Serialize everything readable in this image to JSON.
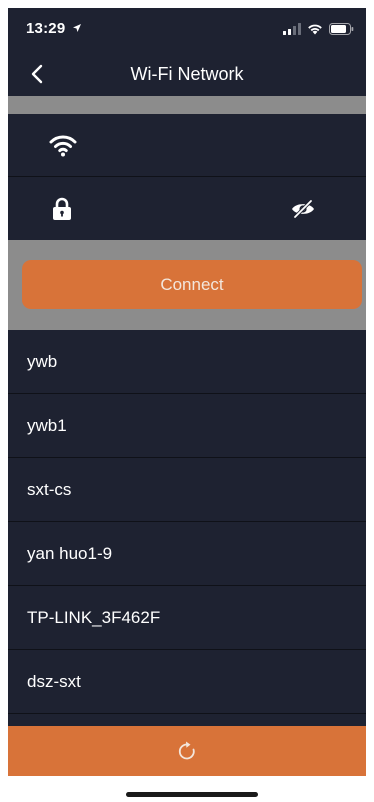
{
  "status_bar": {
    "time": "13:29",
    "location_icon": "location-arrow-icon",
    "signal_icon": "cellular-signal-icon",
    "wifi_icon": "wifi-status-icon",
    "battery_icon": "battery-icon"
  },
  "nav": {
    "title": "Wi-Fi Network",
    "back_icon": "chevron-left-icon"
  },
  "form": {
    "ssid_icon": "wifi-icon",
    "ssid_value": "",
    "password_icon": "lock-icon",
    "password_value": "",
    "visibility_icon": "eye-slash-icon"
  },
  "connect_label": "Connect",
  "networks": [
    {
      "name": "ywb"
    },
    {
      "name": "ywb1"
    },
    {
      "name": "sxt-cs"
    },
    {
      "name": "yan huo1-9"
    },
    {
      "name": "TP-LINK_3F462F"
    },
    {
      "name": "dsz-sxt"
    },
    {
      "name": ""
    }
  ],
  "refresh_icon": "refresh-icon",
  "colors": {
    "background": "#1e2231",
    "accent": "#d87339",
    "band": "#8c8c8c",
    "text": "#ffffff"
  }
}
